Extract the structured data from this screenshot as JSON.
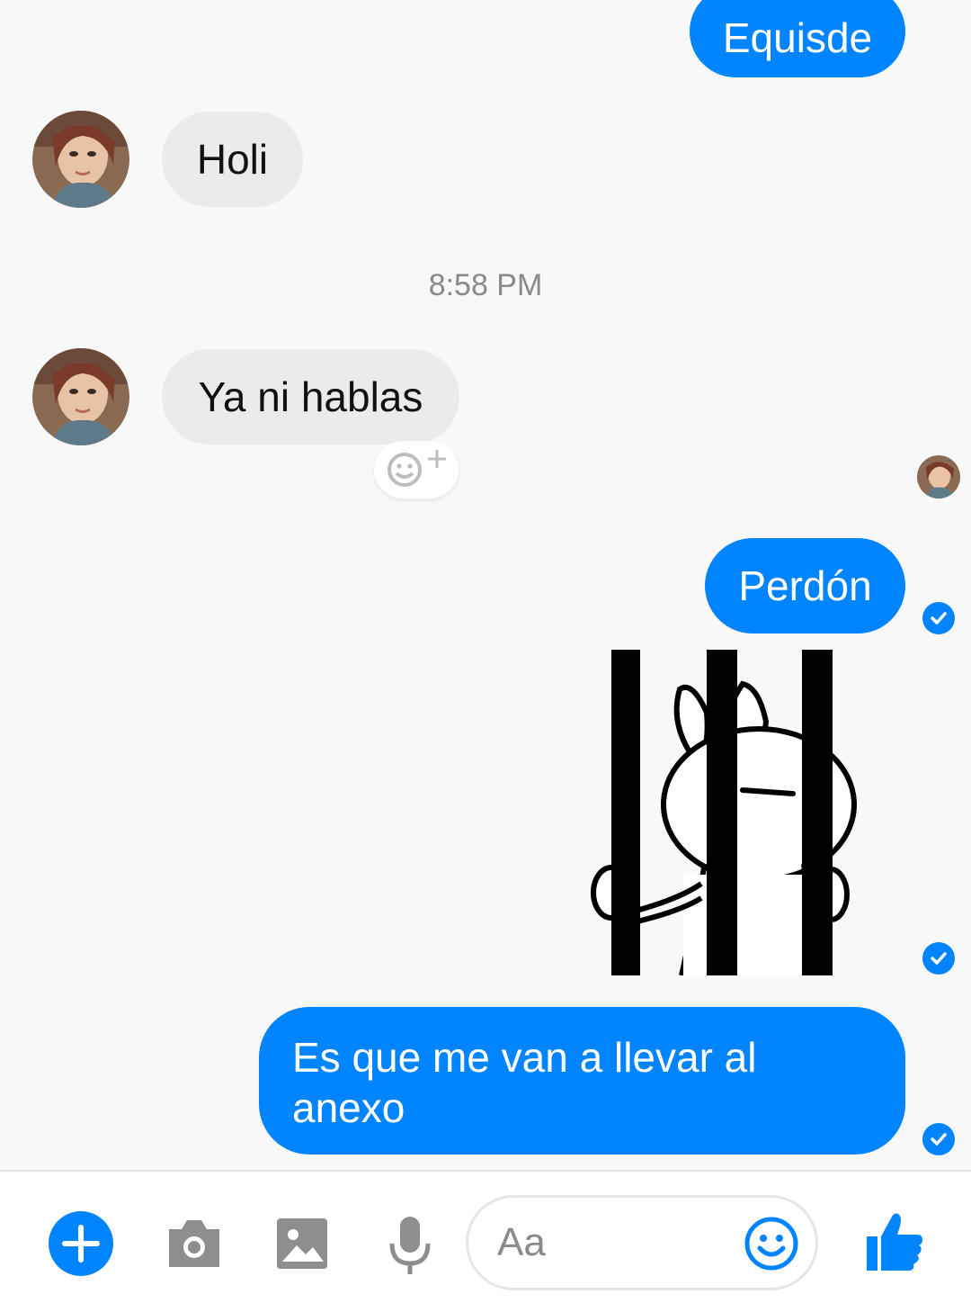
{
  "conversation": {
    "messages": [
      {
        "direction": "outgoing",
        "text": "Equisde"
      },
      {
        "direction": "incoming",
        "text": "Holi"
      },
      {
        "direction": "incoming",
        "text": "Ya ni hablas"
      },
      {
        "direction": "outgoing",
        "text": "Perdón"
      },
      {
        "direction": "outgoing",
        "type": "sticker",
        "sticker": "bunny-behind-bars"
      },
      {
        "direction": "outgoing",
        "text_lines": [
          "Es que me van a llevar al",
          "anexo"
        ]
      }
    ],
    "timestamp": "8:58 PM"
  },
  "composer": {
    "placeholder": "Aa",
    "icons": [
      "plus-icon",
      "camera-icon",
      "image-icon",
      "microphone-icon",
      "emoji-icon",
      "thumbs-up-icon"
    ]
  },
  "colors": {
    "accent": "#0084ff",
    "incoming_bubble": "#ebebeb",
    "chat_background": "#f8f8f8"
  }
}
